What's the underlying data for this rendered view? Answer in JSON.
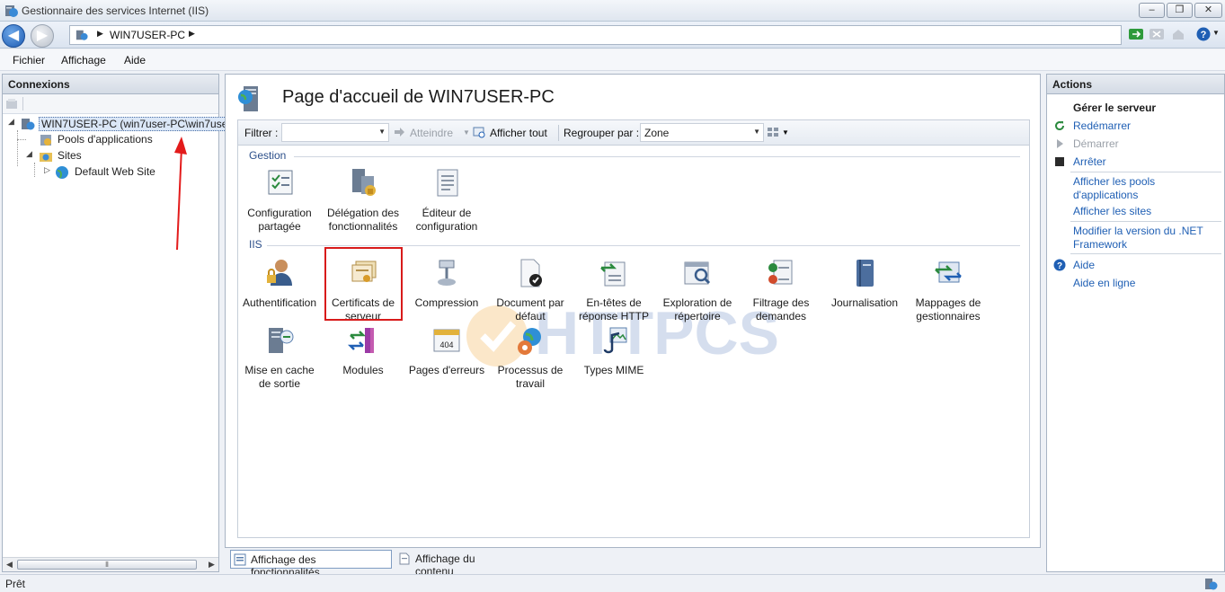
{
  "window": {
    "title": "Gestionnaire des services Internet (IIS)",
    "minimize": "–",
    "maximize": "❐",
    "close": "✕"
  },
  "address": {
    "segment": "WIN7USER-PC"
  },
  "menu": [
    "Fichier",
    "Affichage",
    "Aide"
  ],
  "connections": {
    "header": "Connexions",
    "tree": {
      "server": "WIN7USER-PC (win7user-PC\\win7use",
      "app_pools": "Pools d'applications",
      "sites": "Sites",
      "default_site": "Default Web Site"
    }
  },
  "main": {
    "title": "Page d'accueil de WIN7USER-PC",
    "filter": {
      "filter_label": "Filtrer :",
      "goto": "Atteindre",
      "show_all": "Afficher tout",
      "group_by_label": "Regrouper par :",
      "group_by_value": "Zone"
    },
    "groups": {
      "gestion": {
        "title": "Gestion",
        "items": [
          {
            "l1": "Configuration",
            "l2": "partagée"
          },
          {
            "l1": "Délégation des",
            "l2": "fonctionnalités"
          },
          {
            "l1": "Éditeur de",
            "l2": "configuration"
          }
        ]
      },
      "iis": {
        "title": "IIS",
        "items": [
          {
            "l1": "Authentification",
            "l2": ""
          },
          {
            "l1": "Certificats de",
            "l2": "serveur"
          },
          {
            "l1": "Compression",
            "l2": ""
          },
          {
            "l1": "Document par",
            "l2": "défaut"
          },
          {
            "l1": "En-têtes de",
            "l2": "réponse HTTP"
          },
          {
            "l1": "Exploration de",
            "l2": "répertoire"
          },
          {
            "l1": "Filtrage des",
            "l2": "demandes"
          },
          {
            "l1": "Journalisation",
            "l2": ""
          },
          {
            "l1": "Mappages de",
            "l2": "gestionnaires"
          },
          {
            "l1": "Mise en cache",
            "l2": "de sortie"
          },
          {
            "l1": "Modules",
            "l2": ""
          },
          {
            "l1": "Pages d'erreurs",
            "l2": ""
          },
          {
            "l1": "Processus de",
            "l2": "travail"
          },
          {
            "l1": "Types MIME",
            "l2": ""
          }
        ]
      }
    },
    "watermark": "HTTPCS"
  },
  "view_tabs": {
    "features": "Affichage des fonctionnalités",
    "content": "Affichage du contenu"
  },
  "actions": {
    "header": "Actions",
    "manage_server": "Gérer le serveur",
    "restart": "Redémarrer",
    "start": "Démarrer",
    "stop": "Arrêter",
    "view_pools_1": "Afficher les pools",
    "view_pools_2": "d'applications",
    "view_sites": "Afficher les sites",
    "modify_net_1": "Modifier la version du .NET",
    "modify_net_2": "Framework",
    "help": "Aide",
    "online_help": "Aide en ligne"
  },
  "status": {
    "text": "Prêt"
  },
  "colors": {
    "link": "#1f5fb4",
    "highlight": "#d81b1b",
    "group_title": "#2c4f8a"
  }
}
